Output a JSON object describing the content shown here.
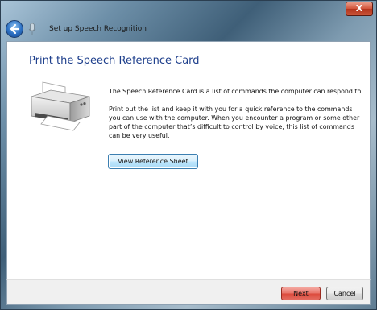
{
  "window": {
    "title": "Set up Speech Recognition",
    "close_glyph": "X"
  },
  "content": {
    "heading": "Print the Speech Reference Card",
    "paragraph1": "The Speech Reference Card is a list of commands the computer can respond to.",
    "paragraph2": "Print out the list and keep it with you for a quick reference to the commands you can use with the computer. When you encounter a program or some other part of the computer that’s difficult to control by voice, this list of commands can be very useful.",
    "view_reference_button": "View Reference Sheet"
  },
  "footer": {
    "next_label": "Next",
    "cancel_label": "Cancel"
  },
  "icons": [
    "close-icon",
    "back-arrow-icon",
    "microphone-icon",
    "printer-icon"
  ],
  "colors": {
    "heading": "#1e3f8c",
    "next_button": "#dc4a3c",
    "default_button_border": "#3c7fb1"
  }
}
